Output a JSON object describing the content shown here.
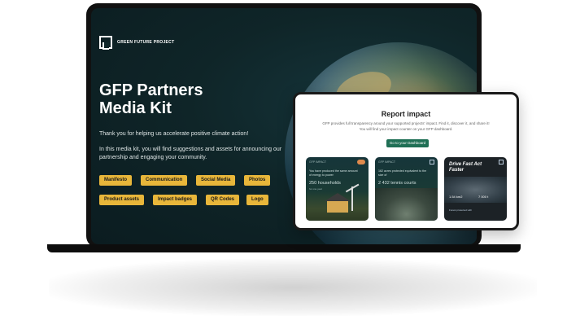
{
  "laptop": {
    "logo_text": "GREEN FUTURE PROJECT",
    "title_line1": "GFP Partners",
    "title_line2": "Media Kit",
    "intro": "Thank you for helping us accelerate positive climate action!",
    "paragraph": "In this media kit, you will find suggestions and assets for announcing our partnership and engaging your community.",
    "tags": [
      "Manifesto",
      "Communication",
      "Social Media",
      "Photos",
      "Product assets",
      "Impact badges",
      "QR Codes",
      "Logo"
    ]
  },
  "report": {
    "title": "Report impact",
    "description_line1": "GFP provides full transparency around your supported projects' impact. Find it, discover it, and share it!",
    "description_line2": "You will find your impact counter on your GFP dashboard.",
    "button_label": "Go to your Dashboard",
    "cards": [
      {
        "brand": "GFP IMPACT",
        "text": "You have produced the same amount of energy to power",
        "big": "250 households",
        "sub": "for one year"
      },
      {
        "brand": "GFP IMPACT",
        "text": "162 acres protected equivalent to the size of",
        "big": "2 432 tennis courts"
      },
      {
        "headline": "Drive Fast Act Faster",
        "stat1": "1.54 km2",
        "stat2": "7 000 t",
        "footer": "Forest protected with"
      }
    ]
  },
  "colors": {
    "accent_tag": "#e8b63a",
    "button": "#1f6f55",
    "screen_bg": "#0f2528"
  }
}
